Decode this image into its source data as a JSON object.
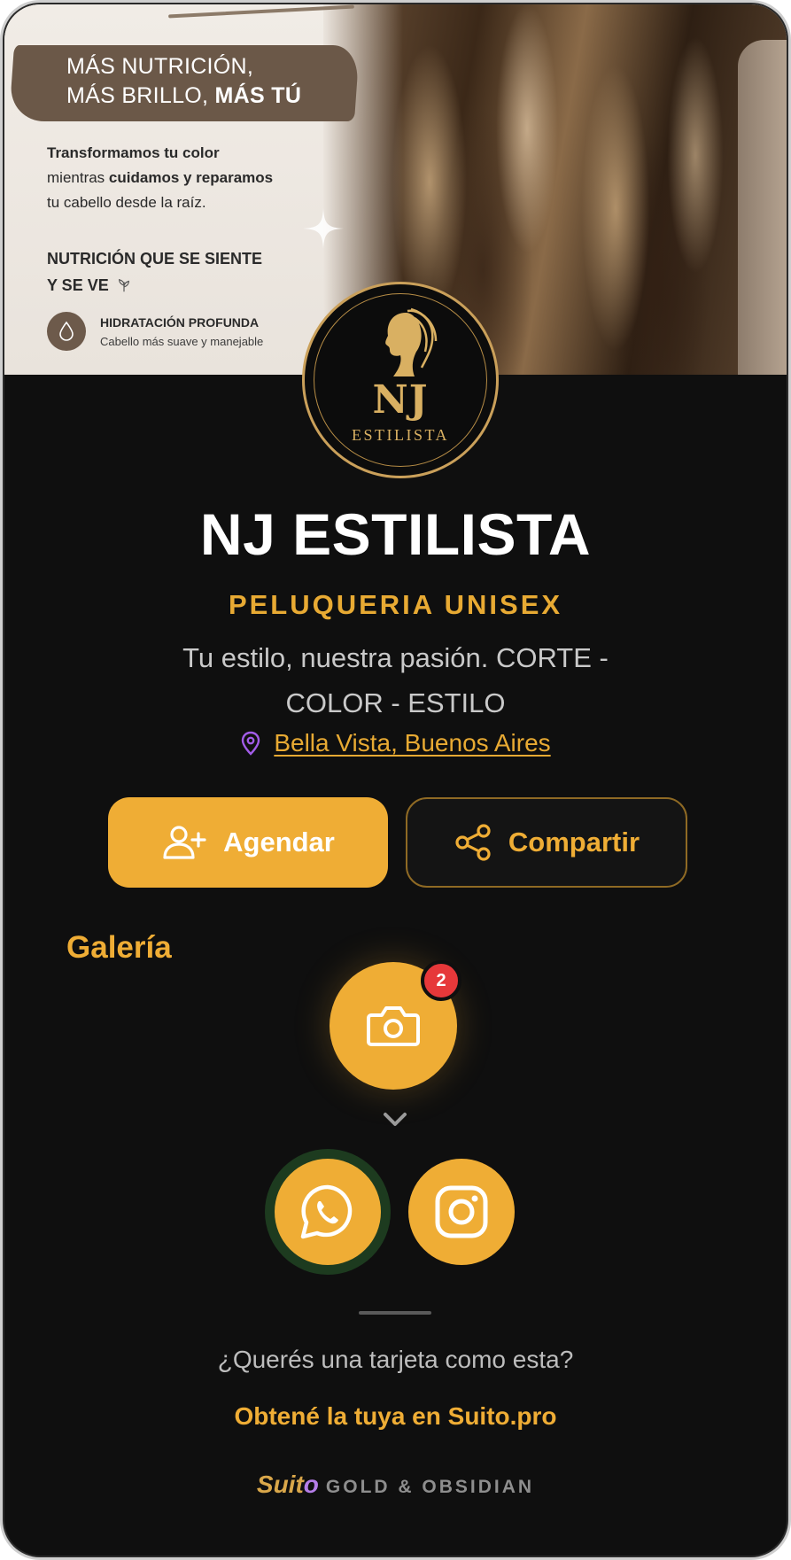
{
  "banner": {
    "headline_line1": "MÁS NUTRICIÓN,",
    "headline_line2_regular": "MÁS BRILLO, ",
    "headline_line2_bold": "MÁS TÚ",
    "para_line1": "Transformamos tu color",
    "para_line2_regular": "mientras ",
    "para_line2_bold": "cuidamos y reparamos",
    "para_line3": "tu cabello desde la raíz.",
    "subhead_line1": "NUTRICIÓN QUE SE SIENTE",
    "subhead_line2": "Y SE VE",
    "feature_title": "HIDRATACIÓN PROFUNDA",
    "feature_sub": "Cabello más suave y manejable"
  },
  "logo": {
    "monogram": "NJ",
    "word": "ESTILISTA"
  },
  "profile": {
    "name": "NJ ESTILISTA",
    "category": "PELUQUERIA UNISEX",
    "tagline": "Tu estilo, nuestra pasión. CORTE - COLOR - ESTILO",
    "location": "Bella Vista, Buenos Aires"
  },
  "actions": {
    "agendar": "Agendar",
    "compartir": "Compartir"
  },
  "gallery": {
    "title": "Galería",
    "badge_count": "2"
  },
  "cta": {
    "question": "¿Querés una tarjeta como esta?",
    "link": "Obtené la tuya en Suito.pro"
  },
  "footer": {
    "brand_main": "Suit",
    "brand_accent": "o",
    "edition": "GOLD & OBSIDIAN"
  },
  "colors": {
    "accent": "#efad35",
    "background": "#0f0f0f",
    "badge": "#e6383a",
    "pin": "#a25ce8"
  }
}
